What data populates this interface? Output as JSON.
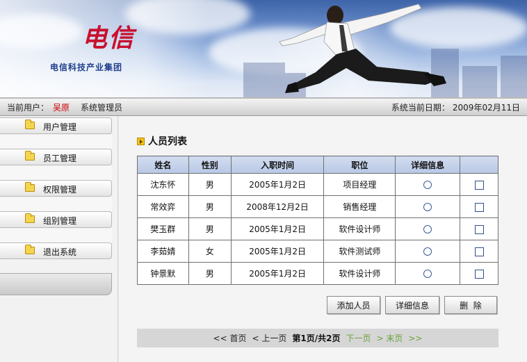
{
  "header": {
    "logo_text": "电信",
    "company_name": "电信科技产业集团"
  },
  "status": {
    "user_label": "当前用户：",
    "user_name": "吴原",
    "role": "系统管理员",
    "date_label": "系统当前日期：",
    "date_value": "2009年02月11日"
  },
  "sidebar": {
    "items": [
      {
        "label": "用户管理",
        "icon": "folder-icon"
      },
      {
        "label": "员工管理",
        "icon": "folder-icon"
      },
      {
        "label": "权限管理",
        "icon": "folder-icon"
      },
      {
        "label": "组别管理",
        "icon": "folder-icon"
      },
      {
        "label": "退出系统",
        "icon": "folder-icon"
      }
    ]
  },
  "main": {
    "title": "人员列表",
    "table": {
      "headers": [
        "姓名",
        "性别",
        "入职时间",
        "职位",
        "详细信息",
        ""
      ],
      "rows": [
        {
          "name": "沈东怀",
          "gender": "男",
          "date": "2005年1月2日",
          "position": "项目经理"
        },
        {
          "name": "常效弈",
          "gender": "男",
          "date": "2008年12月2日",
          "position": "销售经理"
        },
        {
          "name": "樊玉群",
          "gender": "男",
          "date": "2005年1月2日",
          "position": "软件设计师"
        },
        {
          "name": "李茹婧",
          "gender": "女",
          "date": "2005年1月2日",
          "position": "软件测试师"
        },
        {
          "name": "钟景默",
          "gender": "男",
          "date": "2005年1月2日",
          "position": "软件设计师"
        }
      ]
    },
    "buttons": {
      "add": "添加人员",
      "detail": "详细信息",
      "delete": "删  除"
    },
    "pager": {
      "first": "<< 首页",
      "prev": "< 上一页",
      "current": "第1页/共2页",
      "next": "下一页",
      "last": "> 末页",
      "end": ">>"
    }
  }
}
